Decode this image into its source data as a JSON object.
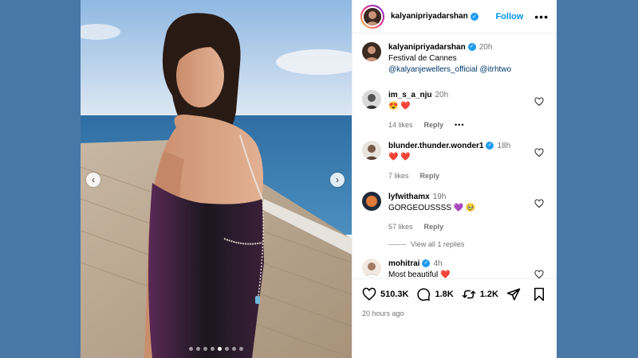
{
  "header": {
    "username": "kalyanipriyadarshan",
    "follow_label": "Follow",
    "more_label": "•••"
  },
  "caption": {
    "username": "kalyanipriyadarshan",
    "time": "20h",
    "text": "Festival de Cannes",
    "mention1": "@kalyanjewellers_official",
    "mention2": "@itrhtwo"
  },
  "comments": [
    {
      "username": "im_s_a_nju",
      "time": "20h",
      "text": "😍 ❤️",
      "likes": "14 likes",
      "reply": "Reply",
      "more": "•••"
    },
    {
      "username": "blunder.thunder.wonder1",
      "time": "18h",
      "text": "❤️ ❤️",
      "likes": "7 likes",
      "reply": "Reply"
    },
    {
      "username": "lyfwithamx",
      "time": "19h",
      "text": "GORGEOUSSSS 💜 🥹",
      "likes": "57 likes",
      "reply": "Reply",
      "view_replies": "View all 1 replies"
    },
    {
      "username": "mohitrai",
      "time": "4h",
      "text": "Most beautiful ❤️"
    }
  ],
  "actions": {
    "likes": "510.3K",
    "comments": "1.8K",
    "reposts": "1.2K"
  },
  "post_time": "20 hours ago",
  "carousel": {
    "count": 8,
    "active_index": 4
  },
  "colors": {
    "background": "#4a78a6",
    "follow": "#0095f6",
    "verified": "#1d9bf0",
    "heart": "#ed1c24"
  }
}
